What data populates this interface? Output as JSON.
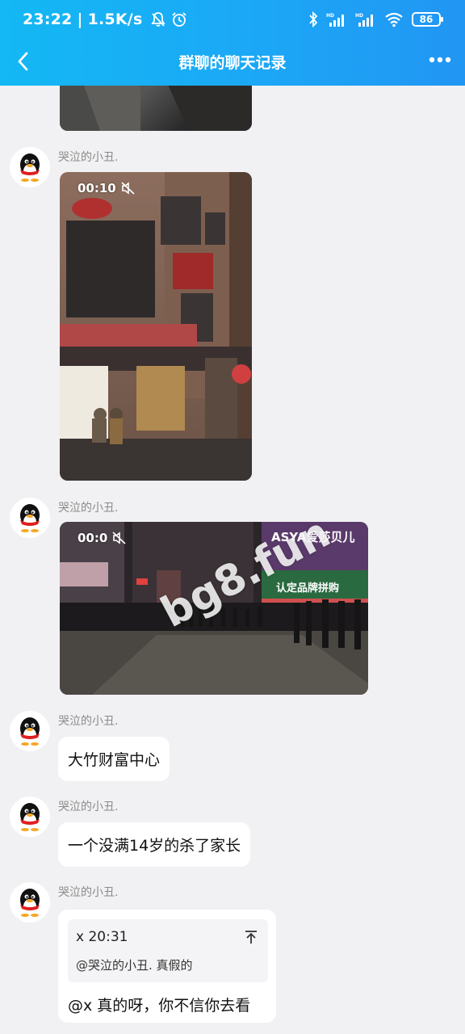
{
  "status": {
    "time": "23:22",
    "speed": "1.5K/s",
    "battery": "86"
  },
  "nav": {
    "title": "群聊的聊天记录"
  },
  "messages": [
    {
      "sender": "哭泣的小丑.",
      "type": "video",
      "duration": "00:10"
    },
    {
      "sender": "哭泣的小丑.",
      "type": "video",
      "duration": "00:0"
    },
    {
      "sender": "哭泣的小丑.",
      "type": "text",
      "text": "大竹财富中心"
    },
    {
      "sender": "哭泣的小丑.",
      "type": "text",
      "text": "一个没满14岁的杀了家长"
    },
    {
      "sender": "哭泣的小丑.",
      "type": "reply",
      "quote_author": "x 20:31",
      "quote_text": "@哭泣的小丑. 真假的",
      "text": "@x 真的呀，你不信你去看"
    }
  ],
  "video_signs": {
    "shop_sign": "ASYA爱莎贝儿",
    "store_sign": "认定品牌拼购"
  },
  "watermark": "bg8.fun",
  "colors": {
    "header_start": "#13b8f4",
    "header_end": "#2196f3",
    "background": "#f1f1f3",
    "bubble": "#ffffff"
  }
}
